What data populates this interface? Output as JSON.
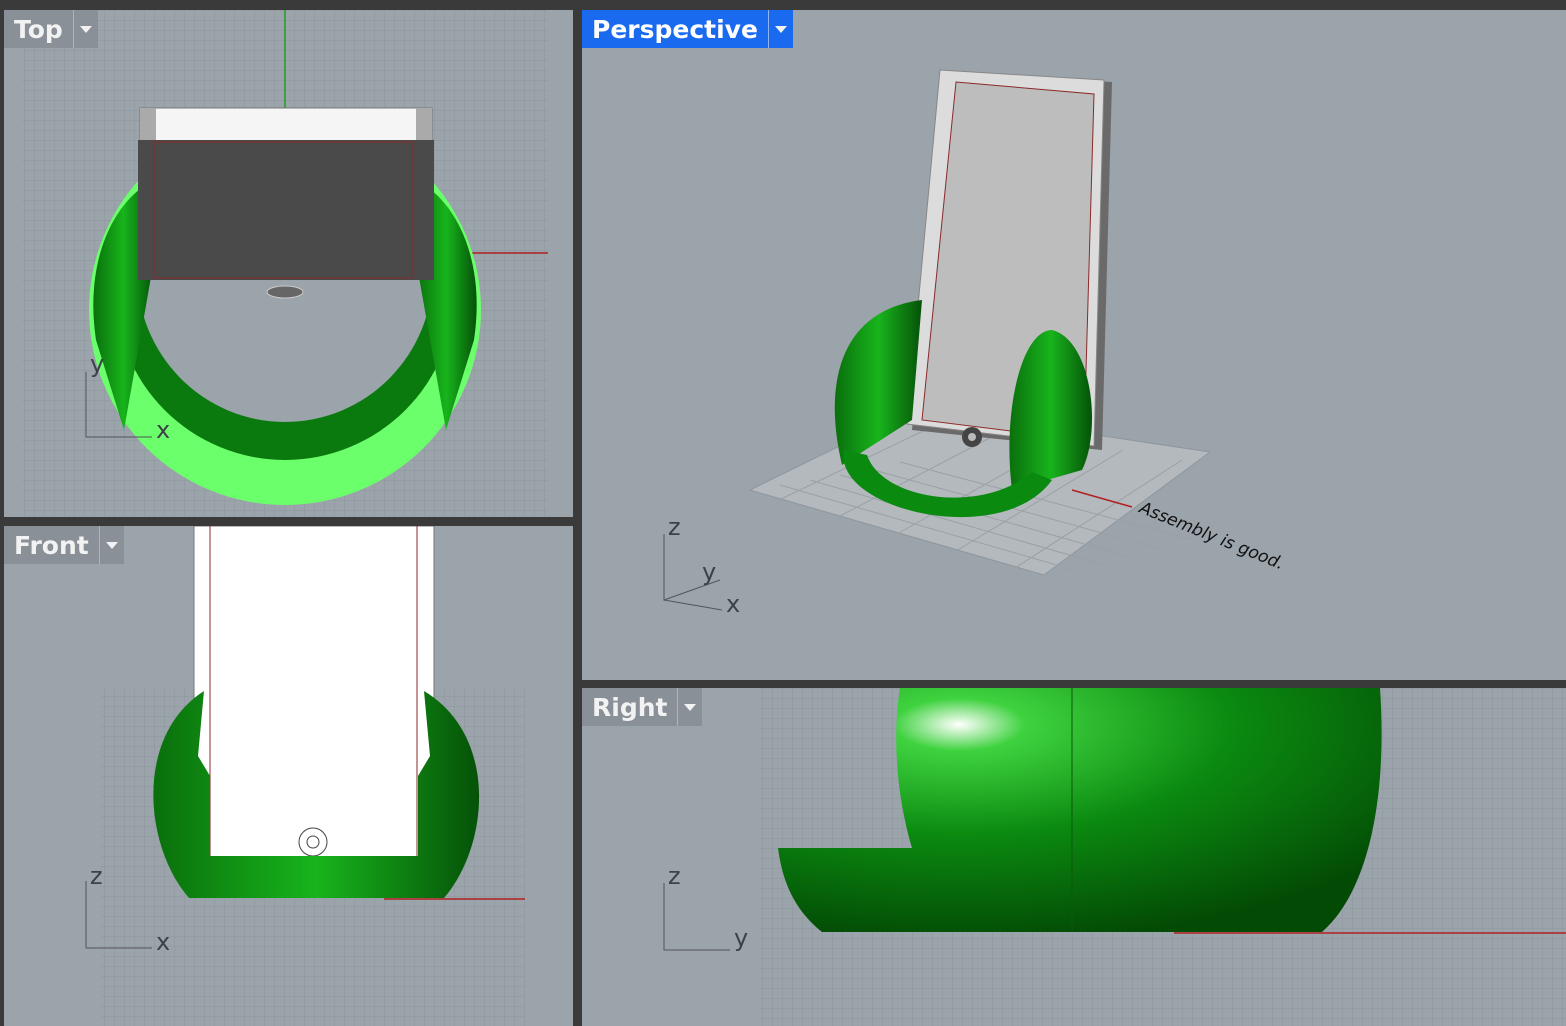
{
  "viewports": {
    "top": {
      "label": "Top",
      "axes": {
        "a": "y",
        "b": "x"
      }
    },
    "front": {
      "label": "Front",
      "axes": {
        "a": "z",
        "b": "x"
      }
    },
    "perspective": {
      "label": "Perspective",
      "axes": {
        "a": "z",
        "b": "y",
        "c": "x"
      },
      "annotation": "Assembly is good."
    },
    "right": {
      "label": "Right",
      "axes": {
        "a": "z",
        "b": "y"
      }
    }
  },
  "colors": {
    "background": "#9ba3ab",
    "grid": "#8e969e",
    "model_green": "#0b8a10",
    "model_green_light": "#6cff6c",
    "phone_body": "#d8d8d8",
    "phone_screen": "#4a4a4a",
    "active_tab": "#1a6af0",
    "x_axis": "#b02020",
    "y_axis": "#20a020"
  },
  "icons": {
    "tab_dropdown": "chevron-down-icon"
  }
}
